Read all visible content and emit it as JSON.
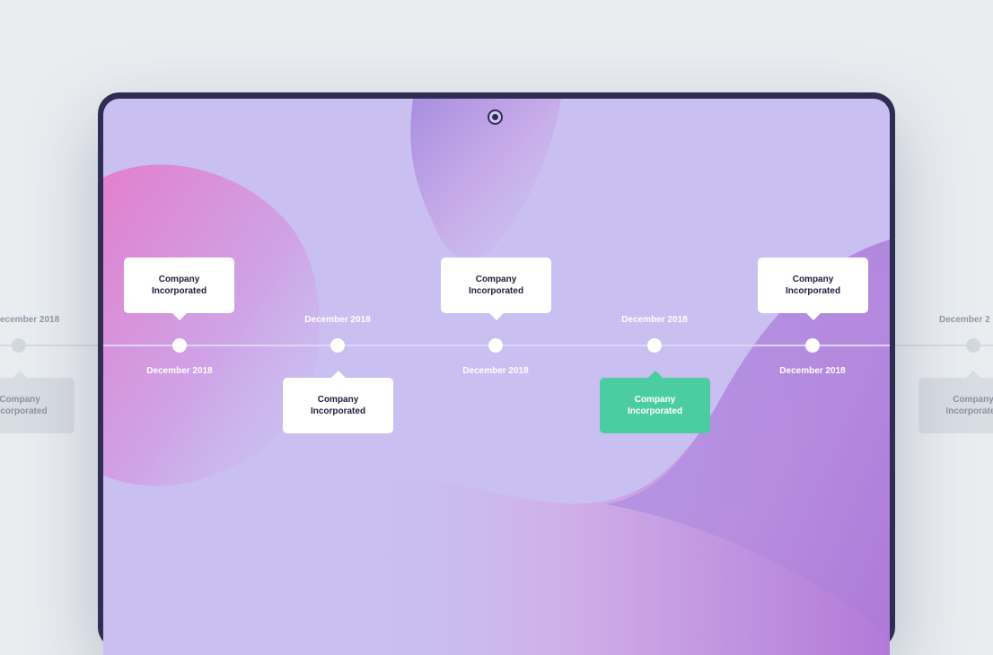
{
  "colors": {
    "page_bg": "#e9edf0",
    "tablet_frame": "#2f2d54",
    "screen_bg": "#c9bff0",
    "active_card": "#4ccda1",
    "card": "#ffffff"
  },
  "timeline": {
    "events": [
      {
        "date": "December 2018",
        "title": "Company Incorporated",
        "card_position": "above",
        "active": false
      },
      {
        "date": "December 2018",
        "title": "Company Incorporated",
        "card_position": "below",
        "active": false
      },
      {
        "date": "December 2018",
        "title": "Company Incorporated",
        "card_position": "above",
        "active": false
      },
      {
        "date": "December 2018",
        "title": "Company Incorporated",
        "card_position": "below",
        "active": true
      },
      {
        "date": "December 2018",
        "title": "Company Incorporated",
        "card_position": "above",
        "active": false
      }
    ]
  },
  "ghost_left": {
    "date": "ecember 2018",
    "title": "Company Incorporated"
  },
  "ghost_right": {
    "date": "December 2",
    "title": "Company Incorporated"
  },
  "icons": {
    "camera": "camera-icon"
  }
}
